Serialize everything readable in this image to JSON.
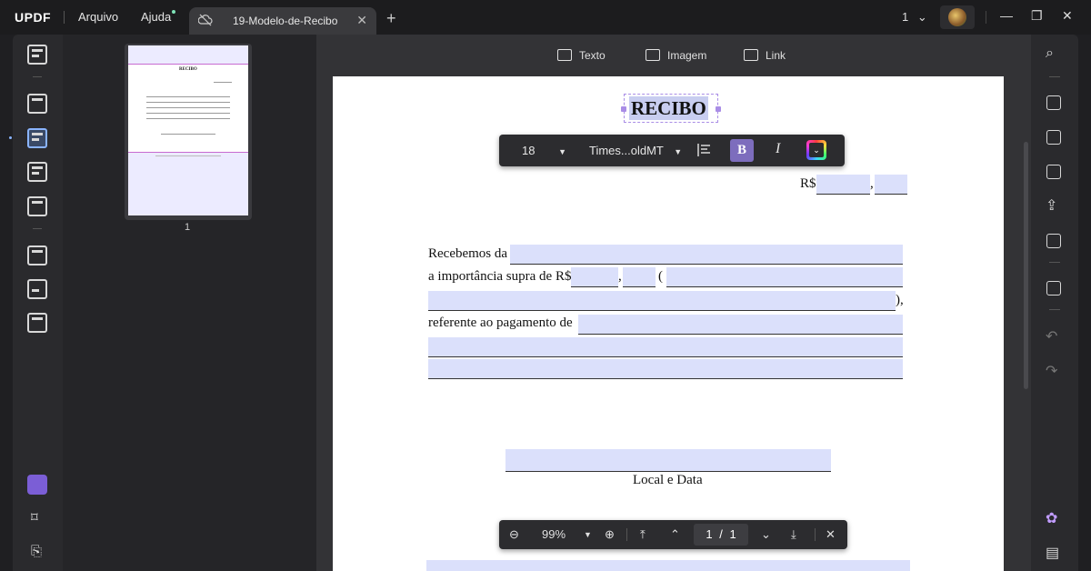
{
  "app": {
    "logo": "UPDF",
    "menu": [
      "Arquivo",
      "Ajuda"
    ]
  },
  "tab": {
    "title": "19-Modelo-de-Recibo",
    "close": "✕",
    "add": "+"
  },
  "header": {
    "page_count": "1",
    "dropdown": "⌄"
  },
  "window": {
    "minimize": "—",
    "restore": "❐",
    "close": "✕"
  },
  "edit_tools": {
    "text": "Texto",
    "image": "Imagem",
    "link": "Link"
  },
  "format_bar": {
    "font_size": "18",
    "font_name": "Times...oldMT",
    "bold": "B",
    "italic": "I"
  },
  "document": {
    "title": "RECIBO",
    "currency_line": "R$",
    "comma": ",",
    "line1": "Recebemos da",
    "line2": "a importância supra de R$",
    "paren_open": "(",
    "paren_close": "),",
    "line4": "referente ao pagamento de",
    "place_date": "Local e Data"
  },
  "thumbnail": {
    "page_label": "1",
    "mini_title": "RECIBO",
    "mini_footer": "Local e Data"
  },
  "zoom_bar": {
    "zoom": "99%",
    "current_page": "1",
    "separator": "/",
    "total_pages": "1"
  },
  "colors": {
    "accent": "#7d6dbd",
    "field_fill": "#dbe0fb",
    "selection": "#a98de6"
  }
}
